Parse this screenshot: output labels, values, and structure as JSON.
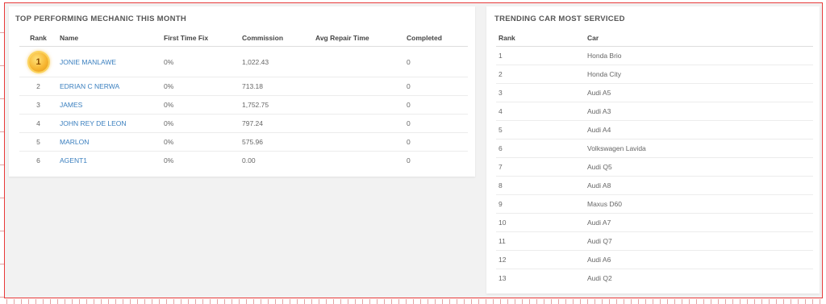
{
  "mechanics": {
    "title": "TOP PERFORMING MECHANIC THIS MONTH",
    "columns": [
      "Rank",
      "Name",
      "First Time Fix",
      "Commission",
      "Avg Repair Time",
      "Completed"
    ],
    "rows": [
      {
        "rank": "1",
        "name": "JONIE MANLAWE",
        "first_time_fix": "0%",
        "commission": "1,022.43",
        "avg_repair_time": "",
        "completed": "0"
      },
      {
        "rank": "2",
        "name": "EDRIAN C NERWA",
        "first_time_fix": "0%",
        "commission": "713.18",
        "avg_repair_time": "",
        "completed": "0"
      },
      {
        "rank": "3",
        "name": "JAMES",
        "first_time_fix": "0%",
        "commission": "1,752.75",
        "avg_repair_time": "",
        "completed": "0"
      },
      {
        "rank": "4",
        "name": "JOHN REY DE LEON",
        "first_time_fix": "0%",
        "commission": "797.24",
        "avg_repair_time": "",
        "completed": "0"
      },
      {
        "rank": "5",
        "name": "MARLON",
        "first_time_fix": "0%",
        "commission": "575.96",
        "avg_repair_time": "",
        "completed": "0"
      },
      {
        "rank": "6",
        "name": "AGENT1",
        "first_time_fix": "0%",
        "commission": "0.00",
        "avg_repair_time": "",
        "completed": "0"
      }
    ],
    "top_badge_icon": "gold-medal-icon"
  },
  "cars": {
    "title": "TRENDING CAR MOST SERVICED",
    "columns": [
      "Rank",
      "Car"
    ],
    "rows": [
      {
        "rank": "1",
        "car": "Honda Brio"
      },
      {
        "rank": "2",
        "car": "Honda City"
      },
      {
        "rank": "3",
        "car": "Audi A5"
      },
      {
        "rank": "4",
        "car": "Audi A3"
      },
      {
        "rank": "5",
        "car": "Audi A4"
      },
      {
        "rank": "6",
        "car": "Volkswagen Lavida"
      },
      {
        "rank": "7",
        "car": "Audi Q5"
      },
      {
        "rank": "8",
        "car": "Audi A8"
      },
      {
        "rank": "9",
        "car": "Maxus D60"
      },
      {
        "rank": "10",
        "car": "Audi A7"
      },
      {
        "rank": "11",
        "car": "Audi Q7"
      },
      {
        "rank": "12",
        "car": "Audi A6"
      },
      {
        "rank": "13",
        "car": "Audi Q2"
      }
    ]
  },
  "colors": {
    "link": "#3a7fbf",
    "frame_border": "#e83a3a",
    "medal": "#f7b733"
  }
}
